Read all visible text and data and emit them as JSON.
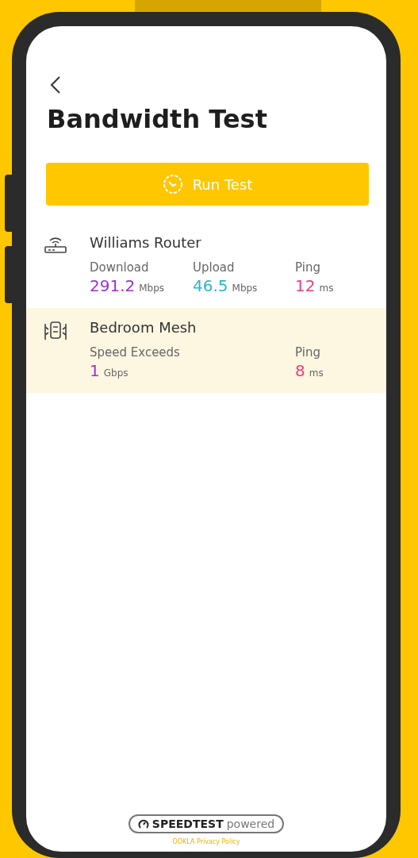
{
  "title": "Bandwidth Test",
  "run_button": {
    "label": "Run Test"
  },
  "devices": [
    {
      "kind": "router",
      "name": "Williams Router",
      "highlighted": false,
      "stats": [
        {
          "label": "Download",
          "value": "291.2",
          "unit": "Mbps",
          "color": "#9b30d9"
        },
        {
          "label": "Upload",
          "value": "46.5",
          "unit": "Mbps",
          "color": "#2bb5c8"
        },
        {
          "label": "Ping",
          "value": "12",
          "unit": "ms",
          "color": "#ee3f78"
        }
      ]
    },
    {
      "kind": "mesh",
      "name": "Bedroom Mesh",
      "highlighted": true,
      "stats": [
        {
          "label": "Speed Exceeds",
          "value": "1",
          "unit": "Gbps",
          "color": "#9b30d9"
        },
        {
          "label": "Ping",
          "value": "8",
          "unit": "ms",
          "color": "#ee3f78"
        }
      ]
    }
  ],
  "footer": {
    "badge_brand": "SPEEDTEST",
    "badge_suffix": "powered",
    "link": "OOKLA Privacy Policy"
  }
}
